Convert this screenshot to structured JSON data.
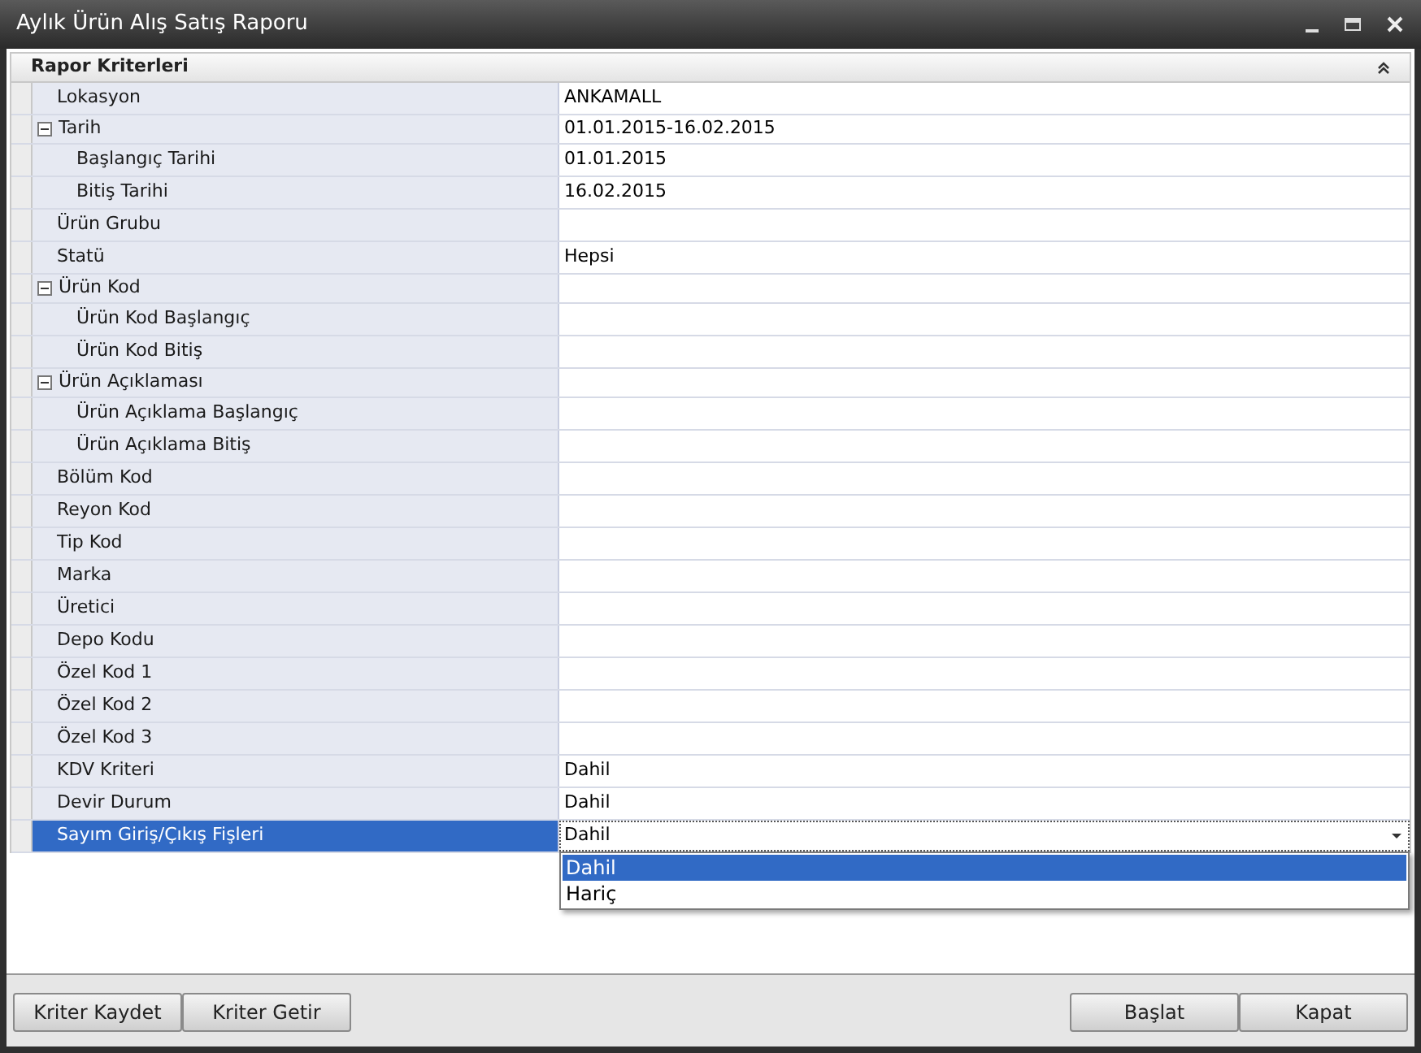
{
  "window": {
    "title": "Aylık Ürün Alış Satış Raporu"
  },
  "panel": {
    "title": "Rapor Kriterleri",
    "expanded": true
  },
  "criteria": [
    {
      "label": "Lokasyon",
      "value": "ANKAMALL",
      "selected": false
    },
    {
      "label": "Tarih",
      "value": "01.01.2015-16.02.2015",
      "selected": false,
      "expanded": true,
      "children": [
        {
          "label": "Başlangıç Tarihi",
          "value": "01.01.2015",
          "selected": false
        },
        {
          "label": "Bitiş Tarihi",
          "value": "16.02.2015",
          "selected": false
        }
      ]
    },
    {
      "label": "Ürün Grubu",
      "selected": false
    },
    {
      "label": "Statü",
      "value": "Hepsi",
      "selected": false
    },
    {
      "label": "Ürün Kod",
      "selected": false,
      "expanded": true,
      "children": [
        {
          "label": "Ürün Kod Başlangıç",
          "selected": false
        },
        {
          "label": "Ürün Kod Bitiş",
          "selected": false
        }
      ]
    },
    {
      "label": "Ürün Açıklaması",
      "selected": false,
      "expanded": true,
      "children": [
        {
          "label": "Ürün Açıklama Başlangıç",
          "selected": false
        },
        {
          "label": "Ürün Açıklama Bitiş",
          "selected": false
        }
      ]
    },
    {
      "label": "Bölüm Kod",
      "selected": false
    },
    {
      "label": "Reyon Kod",
      "selected": false
    },
    {
      "label": "Tip Kod",
      "selected": false
    },
    {
      "label": "Marka",
      "selected": false
    },
    {
      "label": "Üretici",
      "selected": false
    },
    {
      "label": "Depo Kodu",
      "selected": false
    },
    {
      "label": "Özel Kod 1",
      "selected": false
    },
    {
      "label": "Özel Kod 2",
      "selected": false
    },
    {
      "label": "Özel Kod 3",
      "selected": false
    },
    {
      "label": "KDV Kriteri",
      "value": "Dahil",
      "selected": false
    },
    {
      "label": "Devir Durum",
      "value": "Dahil",
      "selected": false
    },
    {
      "label": "Sayım Giriş/Çıkış Fişleri",
      "value": "Dahil",
      "selected": true
    }
  ],
  "dropdown": {
    "options": [
      {
        "label": "Dahil",
        "selected": true
      },
      {
        "label": "Hariç",
        "selected": false
      }
    ]
  },
  "buttons_left": [
    "Kriter Kaydet",
    "Kriter Getir"
  ],
  "buttons_right": [
    "Başlat",
    "Kapat"
  ]
}
